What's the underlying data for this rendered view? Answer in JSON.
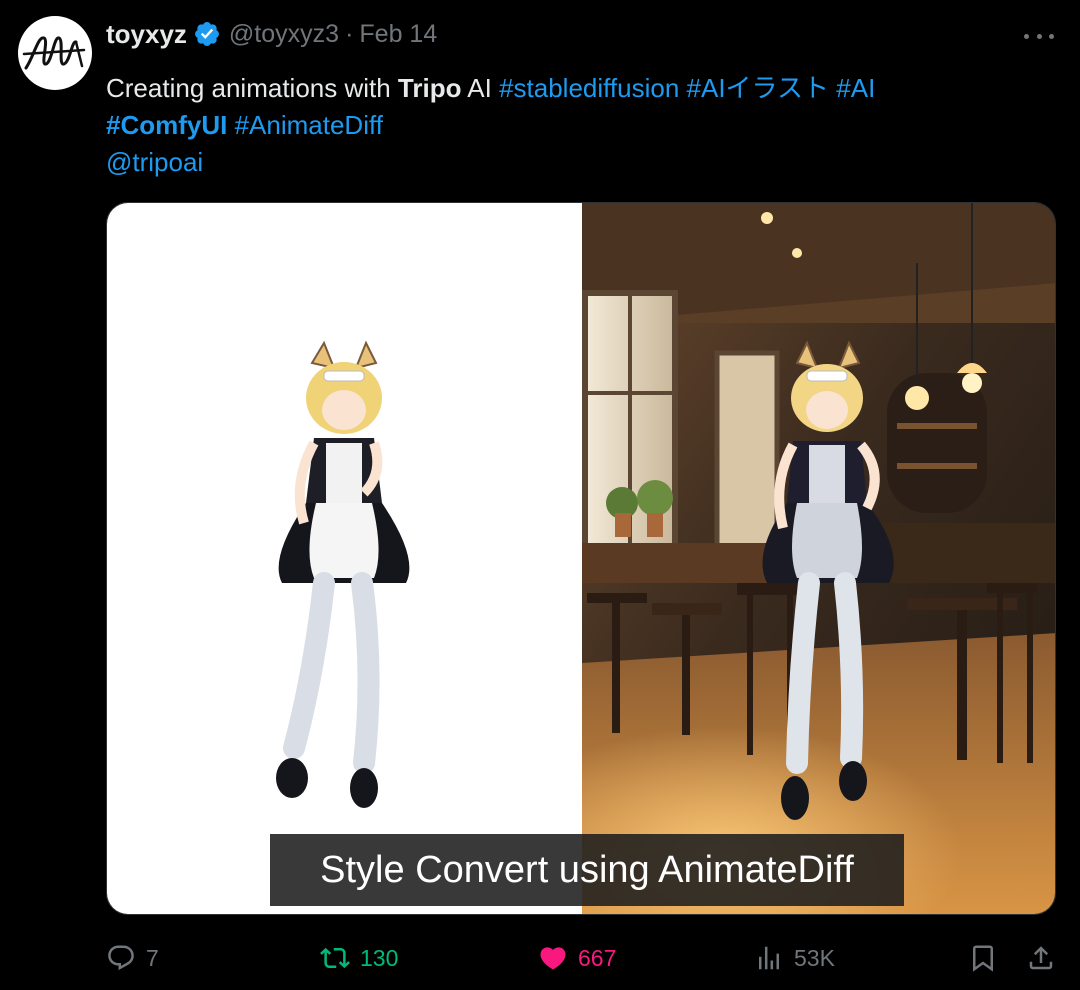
{
  "author": {
    "display_name": "toyxyz",
    "handle": "@toyxyz3",
    "separator": "·",
    "date": "Feb 14"
  },
  "tweet": {
    "line1": {
      "prefix": "Creating animations with ",
      "bold": "Tripo",
      "middle": " AI ",
      "tag1": "#stablediffusion",
      "tag2": "#AIイラスト",
      "tag3": "#AI"
    },
    "line2": {
      "tag4": "#ComfyUI",
      "tag5": "#AnimateDiff"
    },
    "line3": {
      "mention": "@tripoai"
    }
  },
  "media": {
    "caption": "Style Convert using AnimateDiff"
  },
  "actions": {
    "replies": "7",
    "reposts": "130",
    "likes": "667",
    "views": "53K"
  },
  "colors": {
    "background": "#000000",
    "text": "#e7e9ea",
    "muted": "#71767b",
    "link": "#1d9bf0",
    "repost": "#00ba7c",
    "like": "#f91880",
    "verified": "#1d9bf0"
  },
  "icons": {
    "avatar": "signature-logo-avatar",
    "verified": "verified-badge-icon",
    "more": "more-dots-icon",
    "reply": "reply-bubble-icon",
    "repost": "repost-arrows-icon",
    "like": "heart-icon",
    "views": "bar-chart-icon",
    "bookmark": "bookmark-icon",
    "share": "share-upload-icon"
  }
}
